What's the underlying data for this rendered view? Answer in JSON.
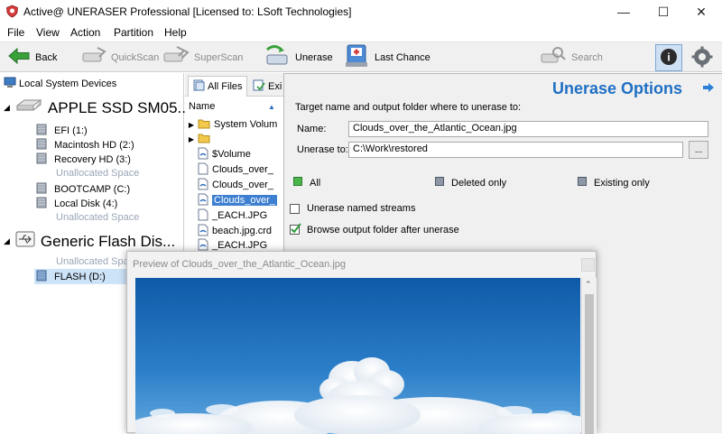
{
  "window": {
    "title": "Active@ UNERASER Professional [Licensed to: LSoft Technologies]",
    "minimize": "—",
    "maximize": "☐",
    "close": "✕"
  },
  "menu": {
    "items": [
      "File",
      "View",
      "Action",
      "Partition",
      "Help"
    ]
  },
  "toolbar": {
    "back": "Back",
    "quickscan": "QuickScan",
    "superscan": "SuperScan",
    "unerase": "Unerase",
    "last_chance": "Last Chance",
    "search": "Search"
  },
  "tree": {
    "header": "Local System Devices",
    "devices": [
      {
        "name": "APPLE SSD SM05...",
        "partitions": [
          {
            "label": "EFI (1:)"
          },
          {
            "label": "Macintosh HD (2:)"
          },
          {
            "label": "Recovery HD (3:)"
          },
          {
            "label": "Unallocated Space"
          },
          {
            "label": "BOOTCAMP (C:)"
          },
          {
            "label": "Local Disk (4:)"
          },
          {
            "label": "Unallocated Space"
          }
        ]
      },
      {
        "name": "Generic Flash Dis...",
        "partitions": [
          {
            "label": "Unallocated Spa"
          },
          {
            "label": "FLASH (D:)"
          }
        ]
      }
    ]
  },
  "files": {
    "tabs": [
      "All Files",
      "Exi"
    ],
    "column_name": "Name",
    "rows": [
      {
        "name": "System Volum"
      },
      {
        "name": ""
      },
      {
        "name": "$Volume"
      },
      {
        "name": "Clouds_over_"
      },
      {
        "name": "Clouds_over_"
      },
      {
        "name": "Clouds_over_"
      },
      {
        "name": "_EACH.JPG"
      },
      {
        "name": "beach.jpg.crd"
      },
      {
        "name": "_EACH.JPG"
      }
    ]
  },
  "options": {
    "title": "Unerase Options",
    "section_label": "Target name and output folder where to unerase to:",
    "name_label": "Name:",
    "name_value": "Clouds_over_the_Atlantic_Ocean.jpg",
    "folder_label": "Unerase to:",
    "folder_value": "C:\\Work\\restored",
    "browse_label": "...",
    "filter_all": "All",
    "filter_deleted": "Deleted only",
    "filter_existing": "Existing only",
    "named_streams": "Unerase named streams",
    "browse_after": "Browse output folder after unerase"
  },
  "preview": {
    "title": "Preview of Clouds_over_the_Atlantic_Ocean.jpg"
  },
  "colors": {
    "accent": "#1f6fc4",
    "selected": "#cde3f7",
    "unallocated": "#9aa6b8"
  }
}
